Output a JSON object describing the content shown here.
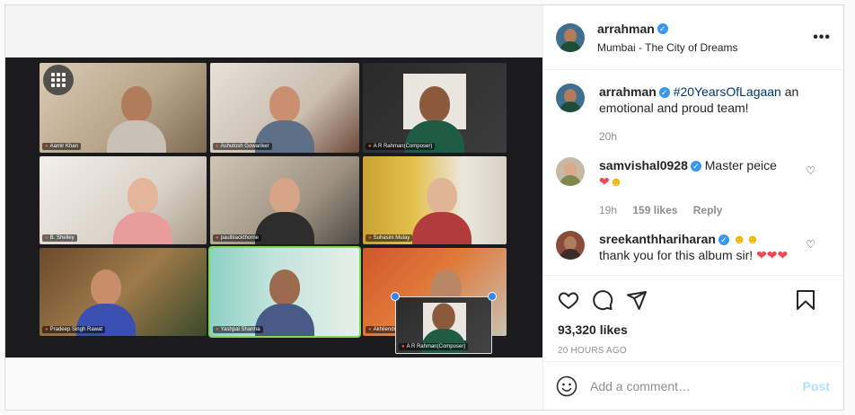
{
  "post": {
    "username": "arrahman",
    "location": "Mumbai - The City of Dreams",
    "more_label": "•••",
    "caption": {
      "username": "arrahman",
      "hashtag": "#20YearsOfLagaan",
      "text": " an emotional and proud team!",
      "time": "20h"
    },
    "comments": [
      {
        "username": "samvishal0928",
        "text": "Master peice",
        "time": "19h",
        "likes": "159 likes",
        "reply": "Reply"
      },
      {
        "username": "sreekanthhariharan",
        "text": "thank you for this album sir!"
      }
    ],
    "likes": "93,320 likes",
    "posted_ago": "20 HOURS AGO",
    "add_comment_placeholder": "Add a comment…",
    "post_button": "Post"
  },
  "video_call": {
    "participants": [
      {
        "name": "Aamir Khan"
      },
      {
        "name": "Ashutosh Gowariker"
      },
      {
        "name": "A R Rahman(Composer)"
      },
      {
        "name": "B. Shelley"
      },
      {
        "name": "paulblackthorne"
      },
      {
        "name": "Suhasini Mulay"
      },
      {
        "name": "Pradeep Singh Rawat"
      },
      {
        "name": "Yashpal Sharma"
      },
      {
        "name": "Akhilendra"
      },
      {
        "name": "A R Rahman(Composer)"
      }
    ]
  },
  "colors": {
    "link": "#00376b",
    "verified": "#3897f0",
    "post_disabled": "#b2dffc",
    "active_speaker": "#7ed957"
  }
}
